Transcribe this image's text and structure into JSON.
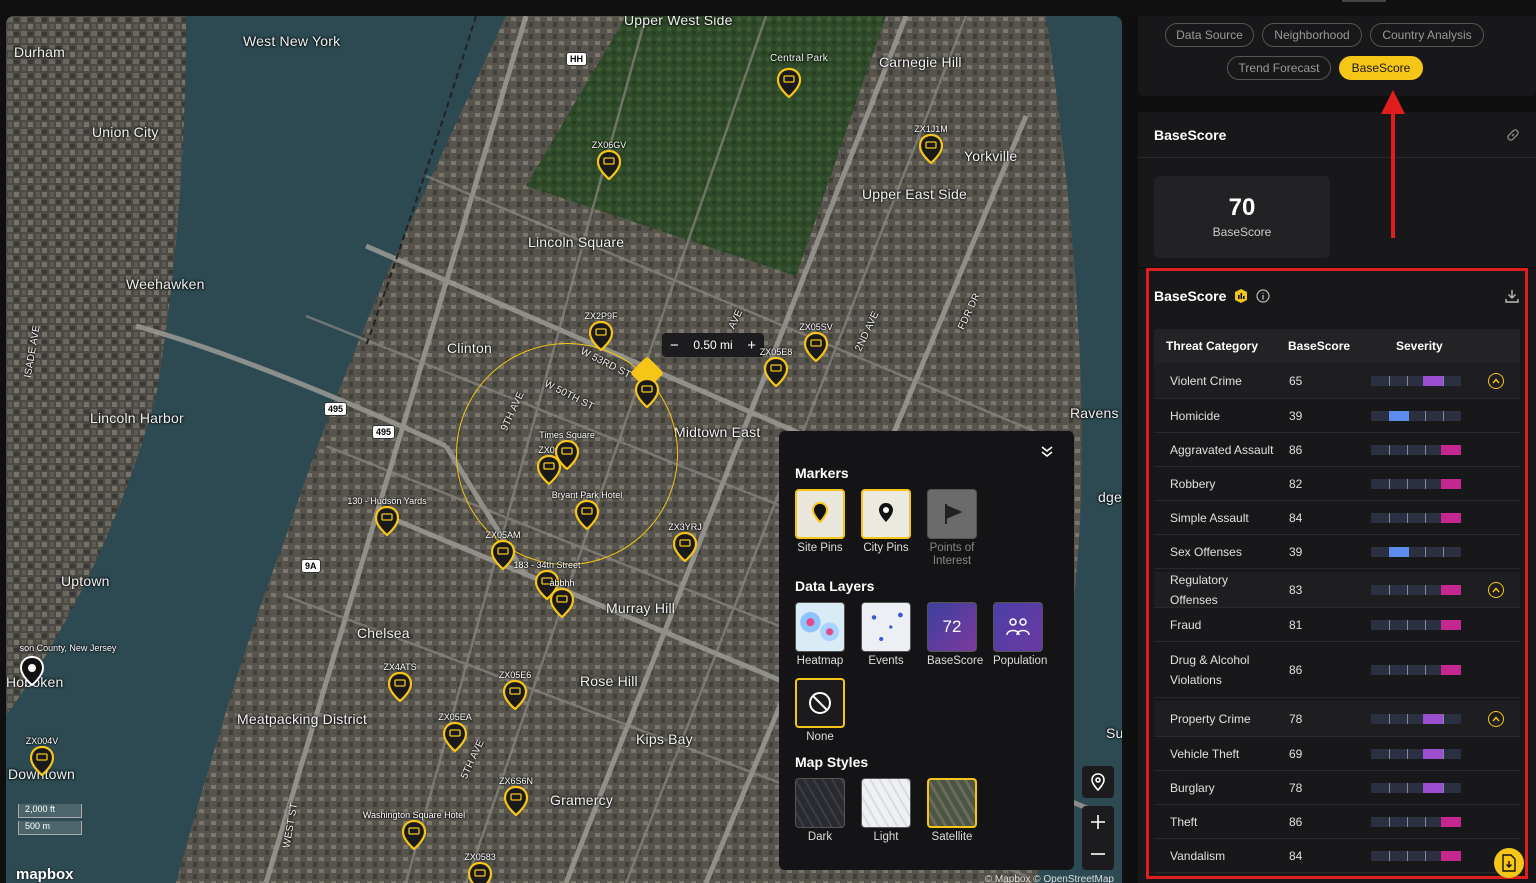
{
  "map": {
    "labels": [
      "Upper West Side",
      "Durham",
      "West New York",
      "Union City",
      "Central Park",
      "Carnegie Hill",
      "Yorkville",
      "Upper East Side",
      "Lincoln Square",
      "Weehawken",
      "Clinton",
      "Lincoln Harbor",
      "Midtown East",
      "Ravens",
      "Uptown",
      "Chelsea",
      "Murray Hill",
      "Rose Hill",
      "Meatpacking District",
      "Kips Bay",
      "Gramercy",
      "Downtown",
      "Hoboken",
      "W 53RD ST",
      "W 50TH ST",
      "9TH AVE",
      "2ND AVE",
      "FDR DR",
      "5TH AVE",
      "WEST ST",
      "AVE",
      "dge",
      "Su",
      "ISADE AVE"
    ],
    "pins": [
      {
        "label": "ZX06GV"
      },
      {
        "label": "ZX1J1M"
      },
      {
        "label": "ZX2P9F"
      },
      {
        "label": "ZX05SV"
      },
      {
        "label": "ZX05E8"
      },
      {
        "label": "ZX00"
      },
      {
        "label": "Times Square"
      },
      {
        "label": "Bryant Park Hotel"
      },
      {
        "label": "130 - Hudson Yards"
      },
      {
        "label": "ZX3YRJ"
      },
      {
        "label": "ZX05AM"
      },
      {
        "label": "183 - 34th Street"
      },
      {
        "label": "abbhh"
      },
      {
        "label": "ZX4ATS"
      },
      {
        "label": "ZX05E6"
      },
      {
        "label": "ZX05EA"
      },
      {
        "label": "ZX004V"
      },
      {
        "label": "ZX6S6N"
      },
      {
        "label": "Washington Square Hotel"
      },
      {
        "label": "ZX0583"
      },
      {
        "label": "son County, New Jersey"
      }
    ],
    "shields": [
      "HH",
      "495",
      "495",
      "9A"
    ],
    "radius_label": "0.50 mi",
    "scale_label_1": "2,000 ft",
    "scale_label_2": "500 m",
    "logo": "mapbox",
    "attribution": "© Mapbox © OpenStreetMap"
  },
  "layer_panel": {
    "markers_title": "Markers",
    "markers": [
      {
        "label": "Site Pins",
        "selected": true
      },
      {
        "label": "City Pins",
        "selected": true
      },
      {
        "label": "Points of Interest",
        "selected": false
      }
    ],
    "data_layers_title": "Data Layers",
    "data_layers": [
      {
        "label": "Heatmap"
      },
      {
        "label": "Events"
      },
      {
        "label": "BaseScore",
        "thumb_text": "72"
      },
      {
        "label": "Population"
      },
      {
        "label": "None",
        "selected": true
      }
    ],
    "map_styles_title": "Map Styles",
    "map_styles": [
      {
        "label": "Dark"
      },
      {
        "label": "Light"
      },
      {
        "label": "Satellite",
        "selected": true
      }
    ]
  },
  "tabs": [
    "Data Source",
    "Neighborhood",
    "Country Analysis",
    "Trend Forecast",
    "BaseScore"
  ],
  "active_tab": "BaseScore",
  "basescore_card": {
    "title": "BaseScore",
    "score": "70",
    "score_label": "BaseScore"
  },
  "table_card": {
    "title": "BaseScore",
    "columns": [
      "Threat Category",
      "BaseScore",
      "Severity"
    ],
    "rows": [
      {
        "name": "Violent Crime",
        "score": "65",
        "group": true
      },
      {
        "name": "Homicide",
        "score": "39"
      },
      {
        "name": "Aggravated Assault",
        "score": "86"
      },
      {
        "name": "Robbery",
        "score": "82"
      },
      {
        "name": "Simple Assault",
        "score": "84"
      },
      {
        "name": "Sex Offenses",
        "score": "39"
      },
      {
        "name": "Regulatory Offenses",
        "score": "83",
        "group": true
      },
      {
        "name": "Fraud",
        "score": "81"
      },
      {
        "name": "Drug & Alcohol Violations",
        "score": "86"
      },
      {
        "name": "Property Crime",
        "score": "78",
        "group": true
      },
      {
        "name": "Vehicle Theft",
        "score": "69"
      },
      {
        "name": "Burglary",
        "score": "78"
      },
      {
        "name": "Theft",
        "score": "86"
      },
      {
        "name": "Vandalism",
        "score": "84"
      }
    ]
  },
  "colors": {
    "accent": "#f5c518",
    "annotation": "#e01e1e",
    "severity_low": "#5b8def",
    "severity_mid": "#9b4fd0",
    "severity_high": "#c4278f"
  }
}
